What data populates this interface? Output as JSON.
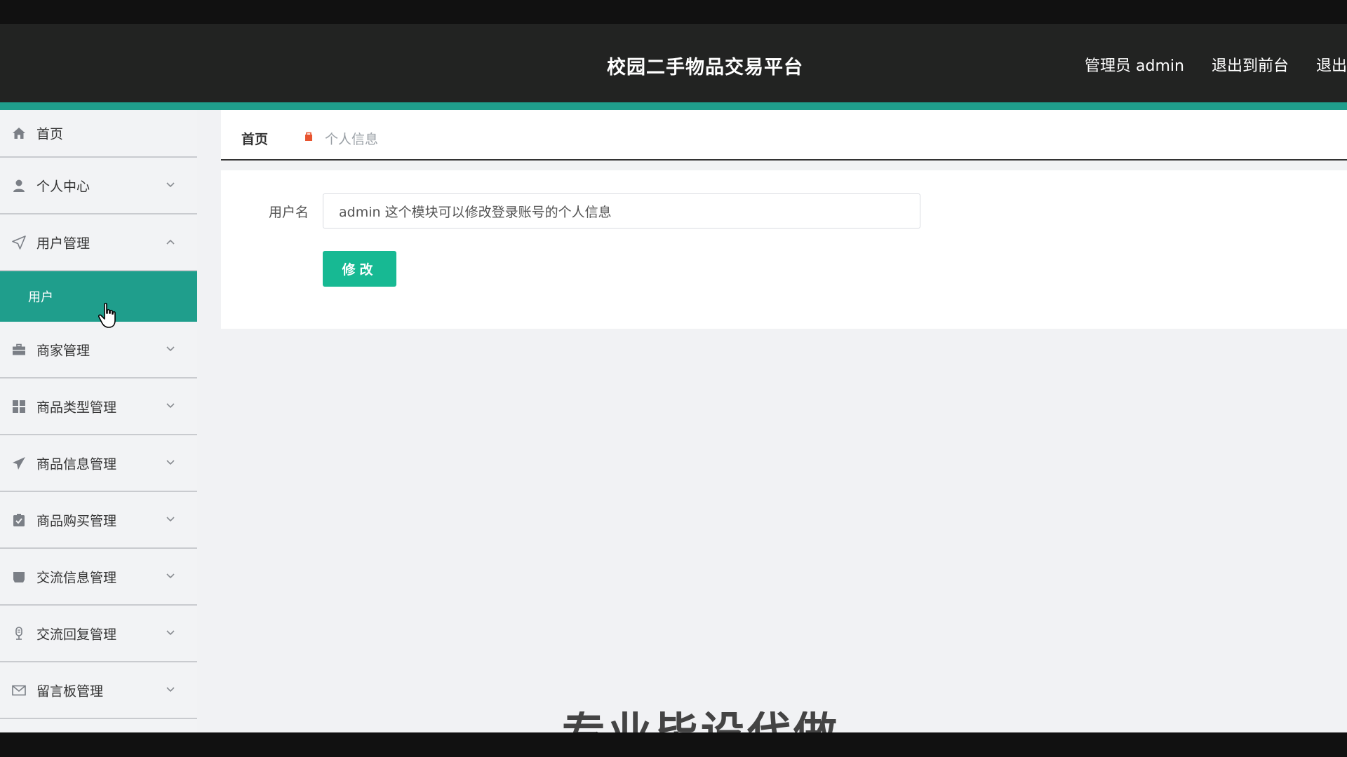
{
  "header": {
    "title": "校园二手物品交易平台",
    "links": [
      "管理员 admin",
      "退出到前台",
      "退出登录"
    ]
  },
  "sidebar": {
    "items": [
      {
        "label": "首页",
        "icon": "home-icon"
      },
      {
        "label": "个人中心",
        "icon": "user-icon"
      },
      {
        "label": "用户管理",
        "icon": "send-icon",
        "expanded": true,
        "children": [
          {
            "label": "用户"
          }
        ]
      },
      {
        "label": "商家管理",
        "icon": "briefcase-icon"
      },
      {
        "label": "商品类型管理",
        "icon": "grid-icon"
      },
      {
        "label": "商品信息管理",
        "icon": "paper-plane-icon"
      },
      {
        "label": "商品购买管理",
        "icon": "clipboard-check-icon"
      },
      {
        "label": "交流信息管理",
        "icon": "inbox-icon"
      },
      {
        "label": "交流回复管理",
        "icon": "microphone-icon"
      },
      {
        "label": "留言板管理",
        "icon": "mail-icon"
      }
    ]
  },
  "breadcrumb": {
    "home": "首页",
    "current": "个人信息"
  },
  "form": {
    "username_label": "用户名",
    "username_value": "admin 这个模块可以修改登录账号的个人信息",
    "submit_label": "修改"
  },
  "watermark": {
    "text": "专业毕设代做"
  },
  "colors": {
    "accent": "#1f9e8c",
    "button": "#17b993",
    "header_bg": "#222322",
    "breadcrumb_sep": "#e8542f"
  }
}
